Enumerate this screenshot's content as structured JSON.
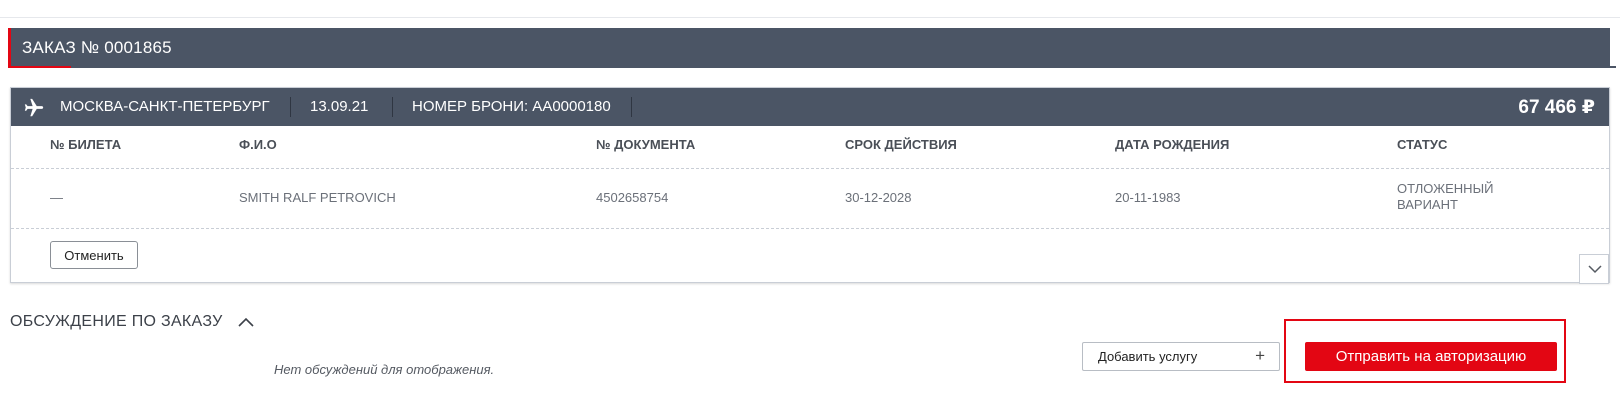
{
  "order": {
    "title": "ЗАКАЗ № 0001865"
  },
  "flight": {
    "route": "МОСКВА-САНКТ-ПЕТЕРБУРГ",
    "date": "13.09.21",
    "booking": "НОМЕР БРОНИ: АА0000180",
    "price": "67 466 ₽",
    "icon": "airplane-icon"
  },
  "table": {
    "headers": [
      "№ БИЛЕТА",
      "Ф.И.О",
      "№ ДОКУМЕНТА",
      "СРОК ДЕЙСТВИЯ",
      "ДАТА РОЖДЕНИЯ",
      "СТАТУС"
    ],
    "rows": [
      {
        "ticket": "—",
        "name": "SMITH RALF PETROVICH",
        "document": "4502658754",
        "expiry": "30-12-2028",
        "birth": "20-11-1983",
        "status": "ОТЛОЖЕННЫЙ ВАРИАНТ"
      }
    ]
  },
  "actions": {
    "cancel_label": "Отменить",
    "add_service_label": "Добавить услугу",
    "submit_label": "Отправить на авторизацию"
  },
  "discussion": {
    "title": "ОБСУЖДЕНИЕ ПО ЗАКАЗУ",
    "empty_text": "Нет обсуждений для отображения."
  },
  "colors": {
    "header_bg": "#4b5565",
    "accent": "#e30613"
  }
}
